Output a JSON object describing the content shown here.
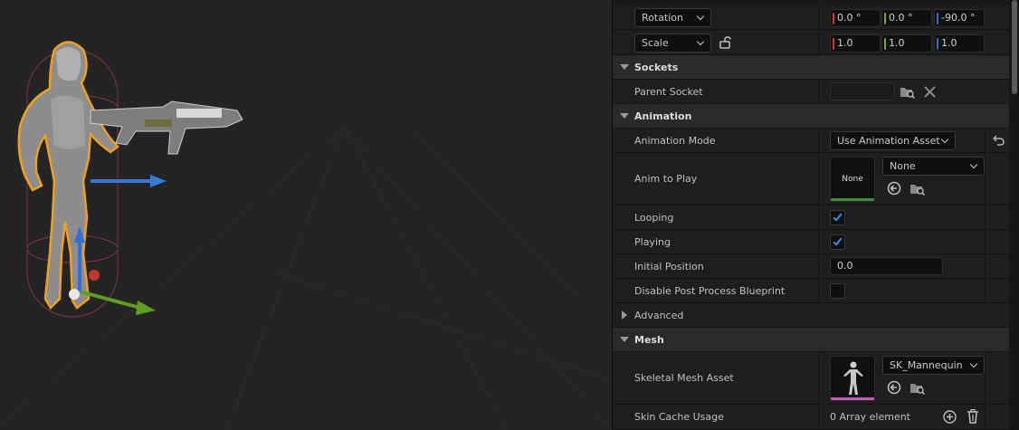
{
  "details": {
    "transform": {
      "rotation": {
        "mode": "Rotation",
        "x": "0.0 °",
        "y": "0.0 °",
        "z": "-90.0 °"
      },
      "scale": {
        "mode": "Scale",
        "x": "1.0",
        "y": "1.0",
        "z": "1.0"
      }
    },
    "sockets": {
      "title": "Sockets",
      "parent_socket_label": "Parent Socket",
      "parent_socket_value": ""
    },
    "animation": {
      "title": "Animation",
      "mode_label": "Animation Mode",
      "mode_value": "Use Animation Asset",
      "anim_to_play_label": "Anim to Play",
      "anim_thumb_text": "None",
      "anim_value": "None",
      "looping_label": "Looping",
      "looping": true,
      "playing_label": "Playing",
      "playing": true,
      "initial_position_label": "Initial Position",
      "initial_position_value": "0.0",
      "disable_pp_label": "Disable Post Process Blueprint",
      "disable_pp": false,
      "advanced_label": "Advanced"
    },
    "mesh": {
      "title": "Mesh",
      "skeletal_mesh_label": "Skeletal Mesh Asset",
      "skeletal_mesh_value": "SK_Mannequin",
      "skin_cache_label": "Skin Cache Usage",
      "skin_cache_value": "0 Array element"
    }
  },
  "colors": {
    "axis_x": "#d9362c",
    "axis_y": "#6fae2a",
    "axis_z": "#2f6fd6",
    "selection_outline": "#f0a020",
    "checkbox_tick": "#2d8cff",
    "anim_thumb_bar": "#3e8a3e",
    "mesh_thumb_bar": "#c85ab8"
  }
}
